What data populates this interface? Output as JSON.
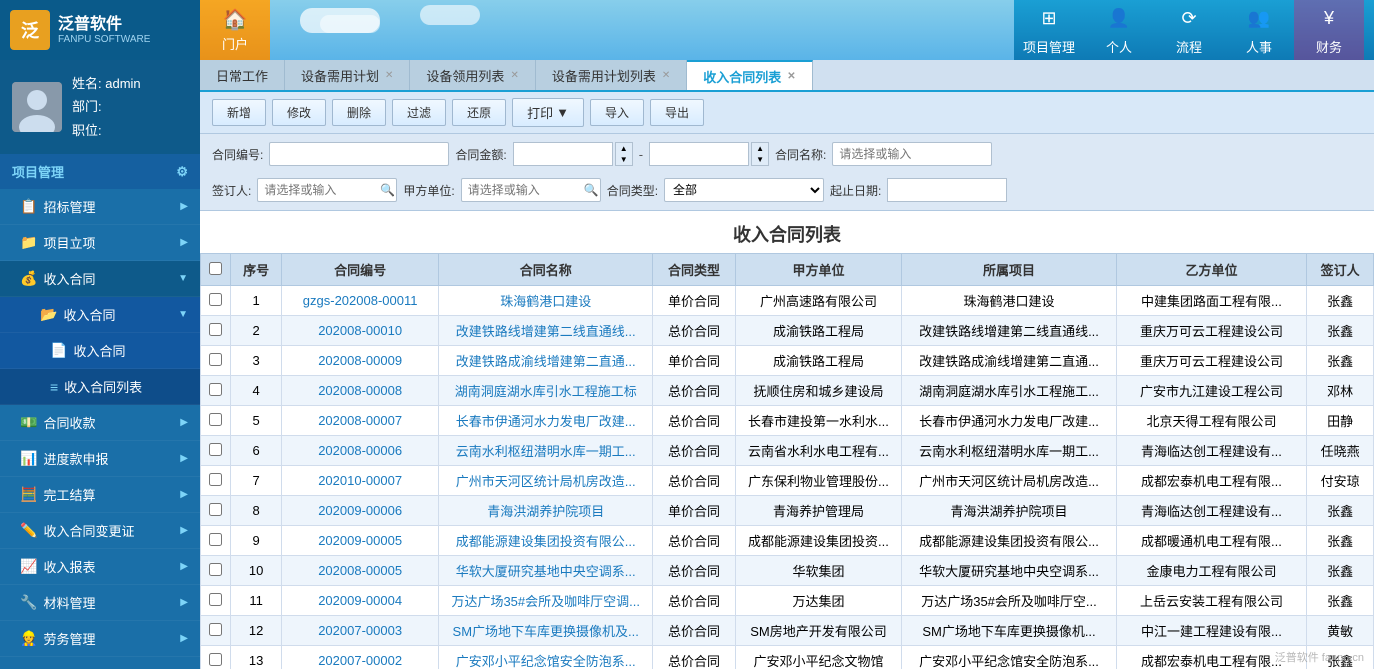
{
  "logo": {
    "icon_text": "泛",
    "name": "泛普软件",
    "sub": "FANPU SOFTWARE"
  },
  "nav_home": {
    "icon": "🏠",
    "label": "门户"
  },
  "header_nav": [
    {
      "id": "project",
      "icon": "⊞",
      "label": "项目管理"
    },
    {
      "id": "personal",
      "icon": "👤",
      "label": "个人"
    },
    {
      "id": "flow",
      "icon": "⟳",
      "label": "流程"
    },
    {
      "id": "hr",
      "icon": "👥",
      "label": "人事"
    },
    {
      "id": "finance",
      "icon": "¥",
      "label": "财务"
    }
  ],
  "user": {
    "name_label": "姓名:",
    "name_value": "admin",
    "dept_label": "部门:",
    "dept_value": "",
    "role_label": "职位:",
    "role_value": ""
  },
  "sidebar": {
    "section": "项目管理",
    "items": [
      {
        "id": "bidding",
        "label": "招标管理",
        "icon": "📋",
        "has_arrow": true
      },
      {
        "id": "project-setup",
        "label": "项目立项",
        "icon": "📁",
        "has_arrow": true
      },
      {
        "id": "income-contract",
        "label": "收入合同",
        "icon": "💰",
        "has_arrow": true,
        "active": true
      },
      {
        "id": "income-contract-sub1",
        "label": "收入合同",
        "icon": "📂",
        "sub": true
      },
      {
        "id": "income-contract-sub2",
        "label": "收入合同",
        "icon": "📄",
        "sub": true
      },
      {
        "id": "income-contract-list",
        "label": "收入合同列表",
        "icon": "≡",
        "sub": true,
        "active": true
      },
      {
        "id": "contract-collection",
        "label": "合同收款",
        "icon": "💵",
        "has_arrow": true
      },
      {
        "id": "progress-claim",
        "label": "进度款申报",
        "icon": "📊",
        "has_arrow": true
      },
      {
        "id": "final-account",
        "label": "完工结算",
        "icon": "🧮",
        "has_arrow": true
      },
      {
        "id": "contract-change",
        "label": "收入合同变更证",
        "icon": "✏️",
        "has_arrow": true
      },
      {
        "id": "income-report",
        "label": "收入报表",
        "icon": "📈",
        "has_arrow": true
      },
      {
        "id": "material-mgmt",
        "label": "材料管理",
        "icon": "🔧",
        "has_arrow": true
      },
      {
        "id": "labor-mgmt",
        "label": "劳务管理",
        "icon": "👷",
        "has_arrow": true
      }
    ]
  },
  "tabs": [
    {
      "id": "daily",
      "label": "日常工作",
      "closable": false
    },
    {
      "id": "equipment-plan",
      "label": "设备需用计划",
      "closable": true
    },
    {
      "id": "equipment-claim",
      "label": "设备领用列表",
      "closable": true
    },
    {
      "id": "equipment-plan-list",
      "label": "设备需用计划列表",
      "closable": true
    },
    {
      "id": "income-contract-list",
      "label": "收入合同列表",
      "closable": true,
      "active": true
    }
  ],
  "toolbar": {
    "add": "新增",
    "edit": "修改",
    "delete": "删除",
    "filter": "过滤",
    "restore": "还原",
    "print": "打印",
    "import": "导入",
    "export": "导出"
  },
  "filter": {
    "contract_no_label": "合同编号:",
    "contract_no_placeholder": "",
    "amount_label": "合同金额:",
    "amount_from": "",
    "amount_to": "",
    "contract_name_label": "合同名称:",
    "contract_name_placeholder": "请选择或输入",
    "signer_label": "签订人:",
    "signer_placeholder": "请选择或输入",
    "party_a_label": "甲方单位:",
    "party_a_placeholder": "请选择或输入",
    "contract_type_label": "合同类型:",
    "contract_type_value": "全部",
    "date_label": "起止日期:",
    "date_value": ""
  },
  "table": {
    "title": "收入合同列表",
    "headers": [
      "",
      "序号",
      "合同编号",
      "合同名称",
      "合同类型",
      "甲方单位",
      "所属项目",
      "乙方单位",
      "签订人"
    ],
    "rows": [
      {
        "seq": 1,
        "no": "gzgs-202008-00011",
        "name": "珠海鹤港口建设",
        "type": "单价合同",
        "party_a": "广州高速路有限公司",
        "project": "珠海鹤港口建设",
        "party_b": "中建集团路面工程有限...",
        "signer": "张鑫"
      },
      {
        "seq": 2,
        "no": "202008-00010",
        "name": "改建铁路线增建第二线直通线...",
        "type": "总价合同",
        "party_a": "成渝铁路工程局",
        "project": "改建铁路线增建第二线直通线...",
        "party_b": "重庆万可云工程建设公司",
        "signer": "张鑫"
      },
      {
        "seq": 3,
        "no": "202008-00009",
        "name": "改建铁路成渝线增建第二直通...",
        "type": "单价合同",
        "party_a": "成渝铁路工程局",
        "project": "改建铁路成渝线增建第二直通...",
        "party_b": "重庆万可云工程建设公司",
        "signer": "张鑫"
      },
      {
        "seq": 4,
        "no": "202008-00008",
        "name": "湖南洞庭湖水库引水工程施工标",
        "type": "总价合同",
        "party_a": "抚顺住房和城乡建设局",
        "project": "湖南洞庭湖水库引水工程施工...",
        "party_b": "广安市九江建设工程公司",
        "signer": "邓林"
      },
      {
        "seq": 5,
        "no": "202008-00007",
        "name": "长春市伊通河水力发电厂改建...",
        "type": "总价合同",
        "party_a": "长春市建投第一水利水...",
        "project": "长春市伊通河水力发电厂改建...",
        "party_b": "北京天得工程有限公司",
        "signer": "田静"
      },
      {
        "seq": 6,
        "no": "202008-00006",
        "name": "云南水利枢纽潜明水库一期工...",
        "type": "总价合同",
        "party_a": "云南省水利水电工程有...",
        "project": "云南水利枢纽潜明水库一期工...",
        "party_b": "青海临达创工程建设有...",
        "signer": "任晓燕"
      },
      {
        "seq": 7,
        "no": "202010-00007",
        "name": "广州市天河区统计局机房改造...",
        "type": "总价合同",
        "party_a": "广东保利物业管理股份...",
        "project": "广州市天河区统计局机房改造...",
        "party_b": "成都宏泰机电工程有限...",
        "signer": "付安琼"
      },
      {
        "seq": 8,
        "no": "202009-00006",
        "name": "青海洪湖养护院项目",
        "type": "单价合同",
        "party_a": "青海养护管理局",
        "project": "青海洪湖养护院项目",
        "party_b": "青海临达创工程建设有...",
        "signer": "张鑫"
      },
      {
        "seq": 9,
        "no": "202009-00005",
        "name": "成都能源建设集团投资有限公...",
        "type": "总价合同",
        "party_a": "成都能源建设集团投资...",
        "project": "成都能源建设集团投资有限公...",
        "party_b": "成都暖通机电工程有限...",
        "signer": "张鑫"
      },
      {
        "seq": 10,
        "no": "202008-00005",
        "name": "华软大厦研究基地中央空调系...",
        "type": "总价合同",
        "party_a": "华软集团",
        "project": "华软大厦研究基地中央空调系...",
        "party_b": "金康电力工程有限公司",
        "signer": "张鑫"
      },
      {
        "seq": 11,
        "no": "202009-00004",
        "name": "万达广场35#会所及咖啡厅空调...",
        "type": "总价合同",
        "party_a": "万达集团",
        "project": "万达广场35#会所及咖啡厅空...",
        "party_b": "上岳云安装工程有限公司",
        "signer": "张鑫"
      },
      {
        "seq": 12,
        "no": "202007-00003",
        "name": "SM广场地下车库更换摄像机及...",
        "type": "总价合同",
        "party_a": "SM房地产开发有限公司",
        "project": "SM广场地下车库更换摄像机...",
        "party_b": "中江一建工程建设有限...",
        "signer": "黄敏"
      },
      {
        "seq": 13,
        "no": "202007-00002",
        "name": "广安邓小平纪念馆安全防泡系...",
        "type": "总价合同",
        "party_a": "广安邓小平纪念文物馆",
        "project": "广安邓小平纪念馆安全防泡系...",
        "party_b": "成都宏泰机电工程有限...",
        "signer": "张鑫"
      }
    ]
  },
  "watermark": "泛普软件 fanpu.cn"
}
